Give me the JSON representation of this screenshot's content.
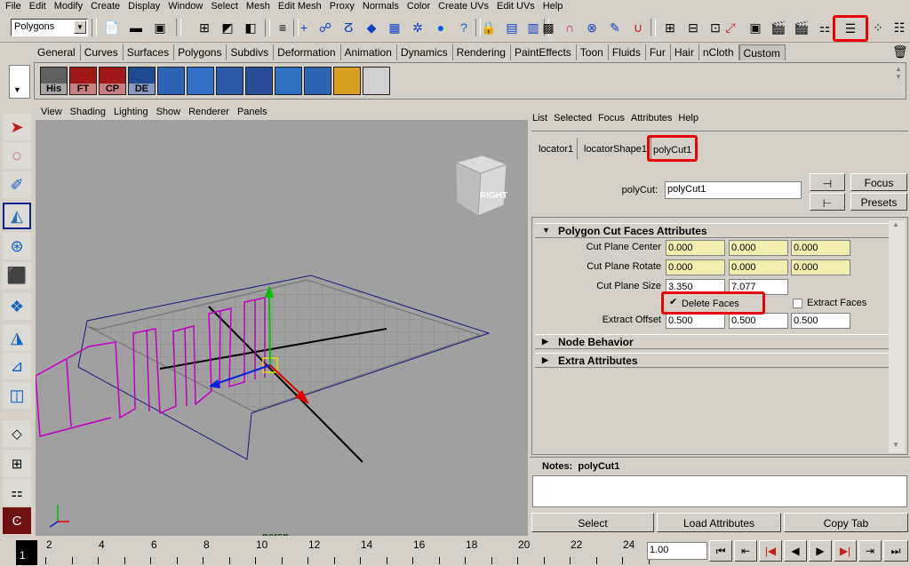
{
  "menubar": [
    "File",
    "Edit",
    "Modify",
    "Create",
    "Display",
    "Window",
    "Select",
    "Mesh",
    "Edit Mesh",
    "Proxy",
    "Normals",
    "Color",
    "Create UVs",
    "Edit UVs",
    "Help"
  ],
  "status": {
    "mode": "Polygons"
  },
  "shelf": {
    "tabs": [
      "General",
      "Curves",
      "Surfaces",
      "Polygons",
      "Subdivs",
      "Deformation",
      "Animation",
      "Dynamics",
      "Rendering",
      "PaintEffects",
      "Toon",
      "Fluids",
      "Fur",
      "Hair",
      "nCloth",
      "Custom"
    ],
    "active_tab": "Custom",
    "icons": [
      {
        "label": "His"
      },
      {
        "label": "FT"
      },
      {
        "label": "CP"
      },
      {
        "label": "DE"
      },
      {
        "label": ""
      },
      {
        "label": ""
      },
      {
        "label": ""
      },
      {
        "label": ""
      },
      {
        "label": ""
      },
      {
        "label": ""
      },
      {
        "label": ""
      },
      {
        "label": ""
      }
    ]
  },
  "viewport": {
    "menu": [
      "View",
      "Shading",
      "Lighting",
      "Show",
      "Renderer",
      "Panels"
    ],
    "camera": "persp",
    "cube_label": "RIGHT"
  },
  "attr": {
    "menu": [
      "List",
      "Selected",
      "Focus",
      "Attributes",
      "Help"
    ],
    "tabs": [
      "locator1",
      "locatorShape1",
      "polyCut1"
    ],
    "node_label": "polyCut:",
    "node_value": "polyCut1",
    "focus": "Focus",
    "presets": "Presets",
    "sections": {
      "main": "Polygon Cut Faces Attributes",
      "node": "Node Behavior",
      "extra": "Extra Attributes"
    },
    "rows": {
      "center": {
        "label": "Cut Plane Center",
        "v": [
          "0.000",
          "0.000",
          "0.000"
        ]
      },
      "rotate": {
        "label": "Cut Plane Rotate",
        "v": [
          "0.000",
          "0.000",
          "0.000"
        ]
      },
      "size": {
        "label": "Cut Plane Size",
        "v": [
          "3.350",
          "7.077"
        ]
      },
      "delete_faces": "Delete Faces",
      "extract_faces": "Extract Faces",
      "offset": {
        "label": "Extract Offset",
        "v": [
          "0.500",
          "0.500",
          "0.500"
        ]
      }
    },
    "notes_label": "Notes:",
    "notes_node": "polyCut1",
    "buttons": [
      "Select",
      "Load Attributes",
      "Copy Tab"
    ]
  },
  "timeline": {
    "current": "1",
    "ticks": [
      "2",
      "4",
      "6",
      "8",
      "10",
      "12",
      "14",
      "16",
      "18",
      "20",
      "22",
      "24"
    ],
    "frame_field": "1.00"
  },
  "colors": {
    "highlight": "#e8000d",
    "field": "#f2eeb0",
    "viewport": "#a0a0a0",
    "wire": "#c000c0"
  }
}
